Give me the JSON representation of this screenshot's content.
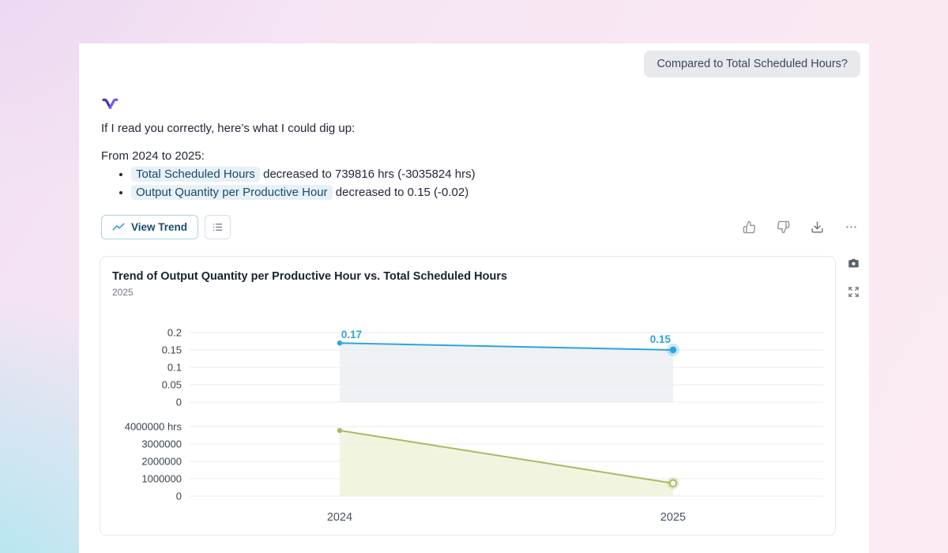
{
  "chip": {
    "label": "Compared to Total Scheduled Hours?"
  },
  "message": {
    "intro": "If I read you correctly, here’s what I could dig up:",
    "period": "From 2024 to 2025:",
    "bullets": [
      {
        "metric": "Total Scheduled Hours",
        "text": " decreased to 739816 hrs (-3035824 hrs)"
      },
      {
        "metric": "Output Quantity per Productive Hour",
        "text": " decreased to 0.15 (-0.02)"
      }
    ]
  },
  "toolbar": {
    "view_trend": "View Trend"
  },
  "chart_card": {
    "title": "Trend of Output Quantity per Productive Hour vs. Total Scheduled Hours",
    "subtitle": "2025"
  },
  "chart_data": [
    {
      "type": "line",
      "name": "Output Quantity per Productive Hour",
      "x": [
        "2024",
        "2025"
      ],
      "values": [
        0.17,
        0.15
      ],
      "data_labels": [
        "0.17",
        "0.15"
      ],
      "ylim": [
        0,
        0.2
      ],
      "yticks": [
        {
          "value": 0,
          "label": "0"
        },
        {
          "value": 0.05,
          "label": "0.05"
        },
        {
          "value": 0.1,
          "label": "0.1"
        },
        {
          "value": 0.15,
          "label": "0.15"
        },
        {
          "value": 0.2,
          "label": "0.2"
        }
      ],
      "line_color": "#2ba6da",
      "fill_color": "#eaeff3",
      "grid": true,
      "legend": "none"
    },
    {
      "type": "area",
      "name": "Total Scheduled Hours",
      "x": [
        "2024",
        "2025"
      ],
      "values": [
        3775640,
        739816
      ],
      "ylim": [
        0,
        4000000
      ],
      "yticks": [
        {
          "value": 0,
          "label": "0"
        },
        {
          "value": 1000000,
          "label": "1000000"
        },
        {
          "value": 2000000,
          "label": "2000000"
        },
        {
          "value": 3000000,
          "label": "3000000"
        },
        {
          "value": 4000000,
          "label": "4000000 hrs"
        }
      ],
      "line_color": "#a6ba62",
      "fill_color": "#eef2d8",
      "grid": true,
      "legend": "none"
    }
  ]
}
